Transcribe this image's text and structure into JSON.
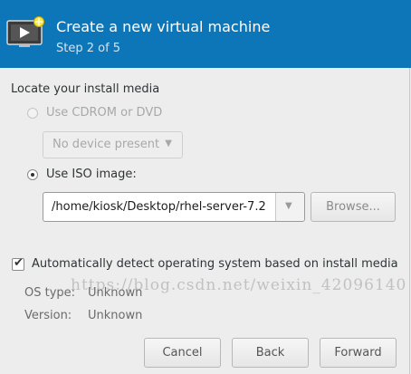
{
  "header": {
    "title": "Create a new virtual machine",
    "step": "Step 2 of 5",
    "icon": "vm-new-icon"
  },
  "media": {
    "section_label": "Locate your install media",
    "cdrom_label": "Use CDROM or DVD",
    "cdrom_device": "No device present",
    "iso_label": "Use ISO image:",
    "iso_path": "/home/kiosk/Desktop/rhel-server-7.2",
    "browse_label": "Browse..."
  },
  "detect": {
    "label": "Automatically detect operating system based on install media",
    "checked": true,
    "os_type_label": "OS type:",
    "os_type_value": "Unknown",
    "version_label": "Version:",
    "version_value": "Unknown"
  },
  "buttons": {
    "cancel": "Cancel",
    "back": "Back",
    "forward": "Forward"
  },
  "watermark": "https://blog.csdn.net/weixin_42096140",
  "colors": {
    "header_bg": "#0d76b8",
    "window_bg": "#ededed"
  }
}
